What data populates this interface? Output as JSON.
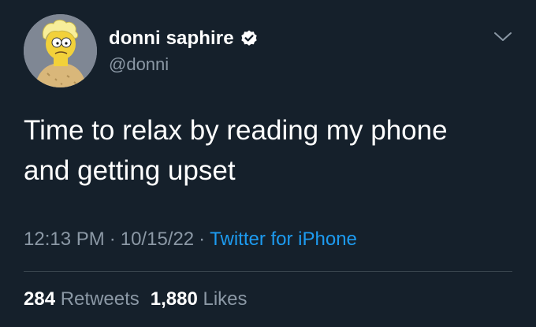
{
  "author": {
    "display_name": "donni saphire",
    "handle": "@donni",
    "verified": true,
    "avatar_icon": "cartoon-character-avatar"
  },
  "menu_icon": "chevron-down-icon",
  "tweet": {
    "text": "Time to relax by reading my phone\nand getting upset"
  },
  "meta": {
    "time": "12:13 PM",
    "separator": "·",
    "date": "10/15/22",
    "source": "Twitter for iPhone"
  },
  "stats": {
    "retweets_count": "284",
    "retweets_label": "Retweets",
    "likes_count": "1,880",
    "likes_label": "Likes"
  },
  "colors": {
    "background": "#15202b",
    "text_primary": "#ffffff",
    "text_secondary": "#8b98a5",
    "link": "#1d9bf0",
    "divider": "#38444d"
  }
}
